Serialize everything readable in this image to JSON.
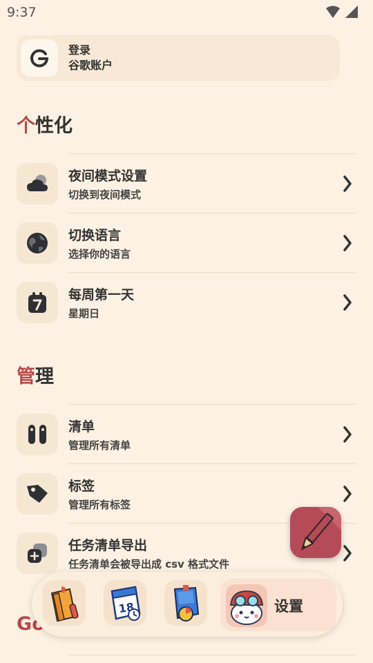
{
  "status": {
    "time": "9:37"
  },
  "account": {
    "line1": "登录",
    "line2": "谷歌账户"
  },
  "sections": {
    "personalize": {
      "first": "个",
      "rest": "性化"
    },
    "manage": {
      "first": "管",
      "rest": "理"
    },
    "partial": "Go"
  },
  "rows": [
    {
      "title": "夜间模式设置",
      "subtitle": "切换到夜间模式",
      "icon": "cloud-icon"
    },
    {
      "title": "切换语言",
      "subtitle": "选择你的语言",
      "icon": "globe-icon"
    },
    {
      "title": "每周第一天",
      "subtitle": "星期日",
      "icon": "calendar-7-icon"
    },
    {
      "title": "清单",
      "subtitle": "管理所有清单",
      "icon": "columns-icon"
    },
    {
      "title": "标签",
      "subtitle": "管理所有标签",
      "icon": "tag-icon"
    },
    {
      "title": "任务清单导出",
      "subtitle": "任务清单会被导出成 csv 格式文件",
      "icon": "export-copy-icon"
    }
  ],
  "nav": {
    "active_label": "设置"
  },
  "colors": {
    "background": "#fcf1e2",
    "accent": "#b74a4a",
    "card": "#f6e7d3"
  }
}
